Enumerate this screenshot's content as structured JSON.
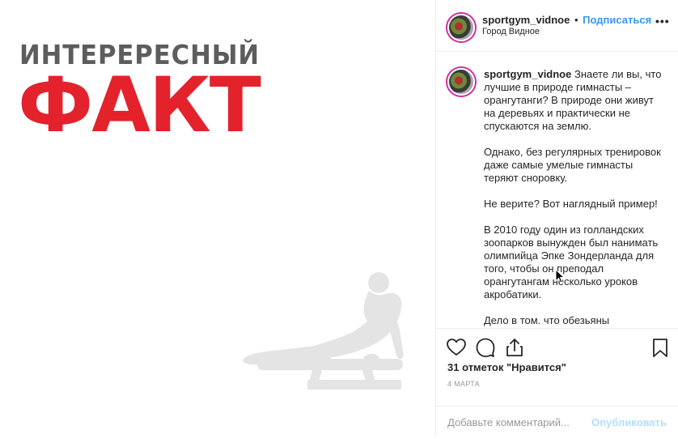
{
  "media": {
    "headline_top": "ИНТЕРЕРЕСНЫЙ",
    "headline_main": "ФАКТ",
    "image_icon": "gymnast-pommel-horse-silhouette",
    "colors": {
      "headline_top": "#5d5d5d",
      "headline_main": "#e3222c",
      "silhouette": "#e4e4e4"
    }
  },
  "post_header": {
    "username": "sportgym_vidnoe",
    "separator": "•",
    "follow_label": "Подписаться",
    "location": "Город Видное",
    "more_icon": "more-dots-icon"
  },
  "caption": {
    "username": "sportgym_vidnoe",
    "first_paragraph": "Знаете ли вы, что лучшие в природе гимнасты – орангутанги? В природе они живут на деревьях и практически не спускаются на землю.",
    "paragraphs": [
      "Однако, без регулярных тренировок даже самые умелые гимнасты теряют сноровку.",
      "Не верите? Вот наглядный пример!",
      "В 2010 году один из голландских зоопарков вынужден был нанимать олимпийца Эпке Зондерланда для того, чтобы он преподал орангутангам несколько уроков акробатики.",
      "Дело в том. что обезьяны"
    ]
  },
  "actions": {
    "like_icon": "heart-icon",
    "comment_icon": "comment-bubble-icon",
    "share_icon": "share-icon",
    "save_icon": "bookmark-icon",
    "likes_text": "31 отметок \"Нравится\"",
    "date": "4 МАРТА"
  },
  "add_comment": {
    "placeholder": "Добавьте комментарий...",
    "publish_label": "Опубликовать",
    "publish_color": "#b2dffc"
  },
  "colors": {
    "link": "#3897f0",
    "text": "#262626",
    "muted": "#999999",
    "border": "#efefef"
  }
}
